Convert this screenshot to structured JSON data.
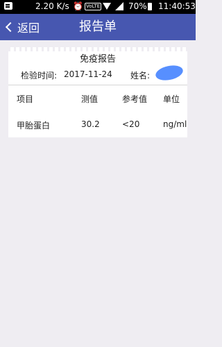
{
  "status_bar": {
    "app_icon": "notification-app-icon",
    "speed": "2.20 K/s",
    "alarm_icon": "alarm-icon",
    "volte": "VoLTE",
    "wifi_icon": "wifi-icon",
    "signal_icon": "signal-icon",
    "battery_percent": "70%",
    "battery_icon": "battery-icon",
    "time": "11:40:53"
  },
  "nav": {
    "back_label": "返回",
    "title": "报告单",
    "background": "#4757b0"
  },
  "report": {
    "title": "免疫报告",
    "date_label": "检验时间:",
    "date_value": "2017-11-24",
    "name_label": "姓名:",
    "table": {
      "headers": [
        "项目",
        "测值",
        "参考值",
        "单位"
      ],
      "rows": [
        [
          "甲胎蛋白",
          "30.2",
          "<20",
          "ng/ml"
        ]
      ]
    }
  }
}
